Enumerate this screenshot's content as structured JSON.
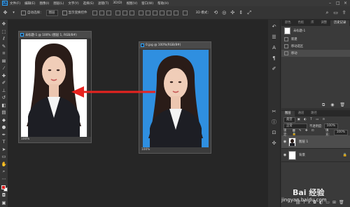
{
  "menu": {
    "logo": "Ps",
    "items": [
      "文件(F)",
      "编辑(E)",
      "图像(I)",
      "图层(L)",
      "文字(Y)",
      "选择(S)",
      "滤镜(T)",
      "3D(D)",
      "视图(V)",
      "窗口(W)",
      "帮助(H)"
    ]
  },
  "options_bar": {
    "auto_select_label": "自动选择：",
    "auto_select_value": "图层",
    "show_transform_label": "显示变换控件",
    "mode_3d_label": "3D 模式："
  },
  "doc_left": {
    "title": "未标题-1 @ 100% (图层 1, RGB/8#)",
    "zoom": "100%"
  },
  "doc_right": {
    "title": "0.jpg @ 100%(RGB/8#)",
    "zoom": "100%"
  },
  "panels": {
    "top_tabs": [
      "颜色",
      "色板",
      "库",
      "调整",
      "历史记录"
    ],
    "history_doc": "未标题-1",
    "history_items": [
      "新建",
      "移动选区",
      "移动"
    ],
    "layers_tabs": [
      "图层",
      "通道",
      "路径"
    ],
    "filter_kind": "类型",
    "blend_mode": "正常",
    "opacity_label": "不透明度:",
    "opacity_value": "100%",
    "lock_label": "锁定:",
    "fill_label": "填充:",
    "fill_value": "100%",
    "layers": [
      {
        "name": "图层 1"
      },
      {
        "name": "背景"
      }
    ]
  },
  "watermark": {
    "text": "Bai 经验",
    "url": "jingyan.baidu.com"
  },
  "colors": {
    "foreground": "#e21d1d",
    "background": "#ffffff",
    "photo_blue_bg": "#2f8fe0",
    "arrow": "#e8231f"
  }
}
